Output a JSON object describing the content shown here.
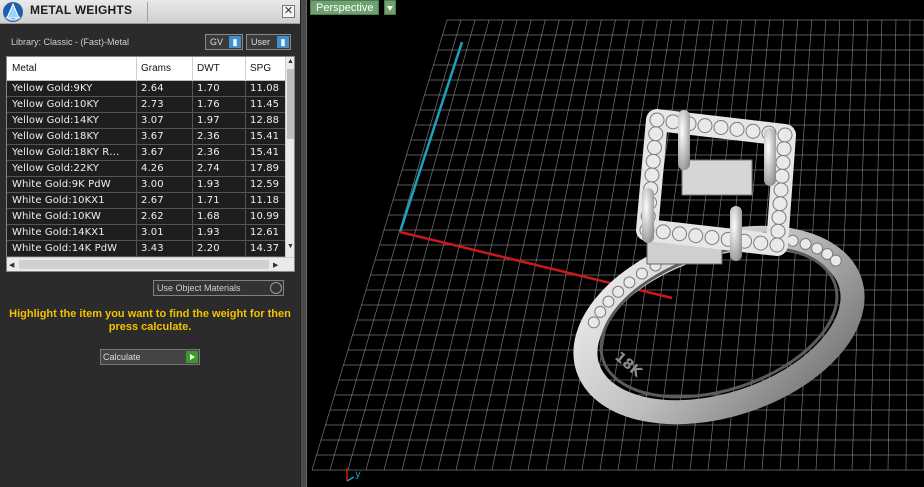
{
  "panel": {
    "title": "METAL WEIGHTS",
    "close_glyph": "✕",
    "library_label": "Library: Classic - (Fast)-Metal",
    "gv_dropdown": "GV",
    "user_dropdown": "User",
    "dropdown_glyph": "▮"
  },
  "table": {
    "headers": {
      "metal": "Metal",
      "grams": "Grams",
      "dwt": "DWT",
      "spg": "SPG"
    },
    "rows": [
      {
        "metal": "Yellow Gold:9KY",
        "grams": "2.64",
        "dwt": "1.70",
        "spg": "11.08"
      },
      {
        "metal": "Yellow Gold:10KY",
        "grams": "2.73",
        "dwt": "1.76",
        "spg": "11.45"
      },
      {
        "metal": "Yellow Gold:14KY",
        "grams": "3.07",
        "dwt": "1.97",
        "spg": "12.88"
      },
      {
        "metal": "Yellow Gold:18KY",
        "grams": "3.67",
        "dwt": "2.36",
        "spg": "15.41"
      },
      {
        "metal": "Yellow Gold:18KY R…",
        "grams": "3.67",
        "dwt": "2.36",
        "spg": "15.41"
      },
      {
        "metal": "Yellow Gold:22KY",
        "grams": "4.26",
        "dwt": "2.74",
        "spg": "17.89"
      },
      {
        "metal": "White Gold:9K PdW",
        "grams": "3.00",
        "dwt": "1.93",
        "spg": "12.59"
      },
      {
        "metal": "White Gold:10KX1",
        "grams": "2.67",
        "dwt": "1.71",
        "spg": "11.18"
      },
      {
        "metal": "White Gold:10KW",
        "grams": "2.62",
        "dwt": "1.68",
        "spg": "10.99"
      },
      {
        "metal": "White Gold:14KX1",
        "grams": "3.01",
        "dwt": "1.93",
        "spg": "12.61"
      },
      {
        "metal": "White Gold:14K PdW",
        "grams": "3.43",
        "dwt": "2.20",
        "spg": "14.37"
      }
    ]
  },
  "use_object_materials": "Use Object Materials",
  "hint": "Highlight the item you want to find the weight for then press calculate.",
  "calculate_label": "Calculate",
  "viewport": {
    "view_name": "Perspective",
    "axis_label": "y",
    "ring_engraving": "18K"
  },
  "colors": {
    "hint_text": "#f2c200",
    "viewport_label_bg": "#6fa06f",
    "x_axis": "#c81a1a",
    "y_axis": "#1aa3b8",
    "grid": "#9a9a9a"
  }
}
